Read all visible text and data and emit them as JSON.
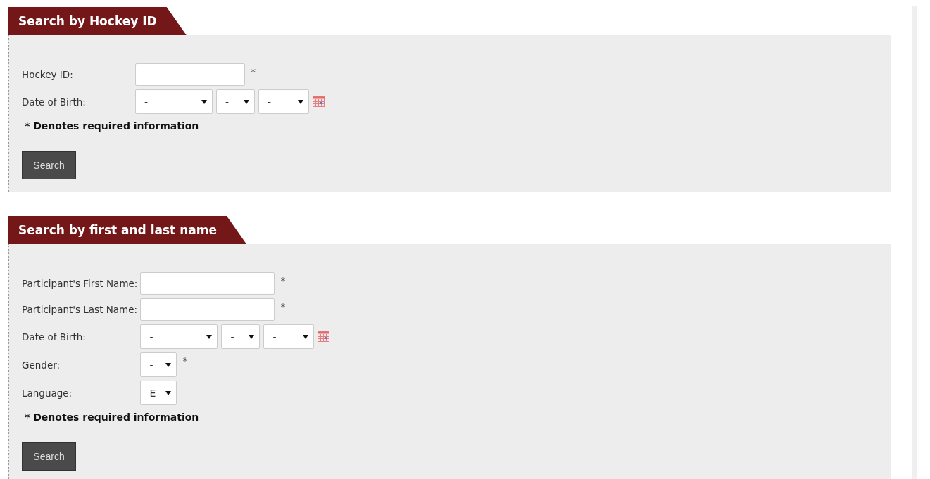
{
  "sections": [
    {
      "title": "Search by Hockey ID",
      "fields": [
        {
          "kind": "text",
          "label": "Hockey ID:",
          "mark": "*"
        },
        {
          "kind": "date",
          "label": "Date of Birth:",
          "values": [
            "-",
            "-",
            "-"
          ]
        }
      ],
      "note": "* Denotes required information",
      "button": "Search"
    },
    {
      "title": "Search by first and last name",
      "fields": [
        {
          "kind": "text",
          "label": "Participant's First Name:",
          "mark": "*"
        },
        {
          "kind": "text",
          "label": "Participant's Last Name:",
          "mark": "*"
        },
        {
          "kind": "date",
          "label": "Date of Birth:",
          "values": [
            "-",
            "-",
            "-"
          ]
        },
        {
          "kind": "select",
          "label": "Gender:",
          "value": "-",
          "mark": "*"
        },
        {
          "kind": "select",
          "label": "Language:",
          "value": "E"
        }
      ],
      "note": "* Denotes required information",
      "button": "Search"
    }
  ]
}
